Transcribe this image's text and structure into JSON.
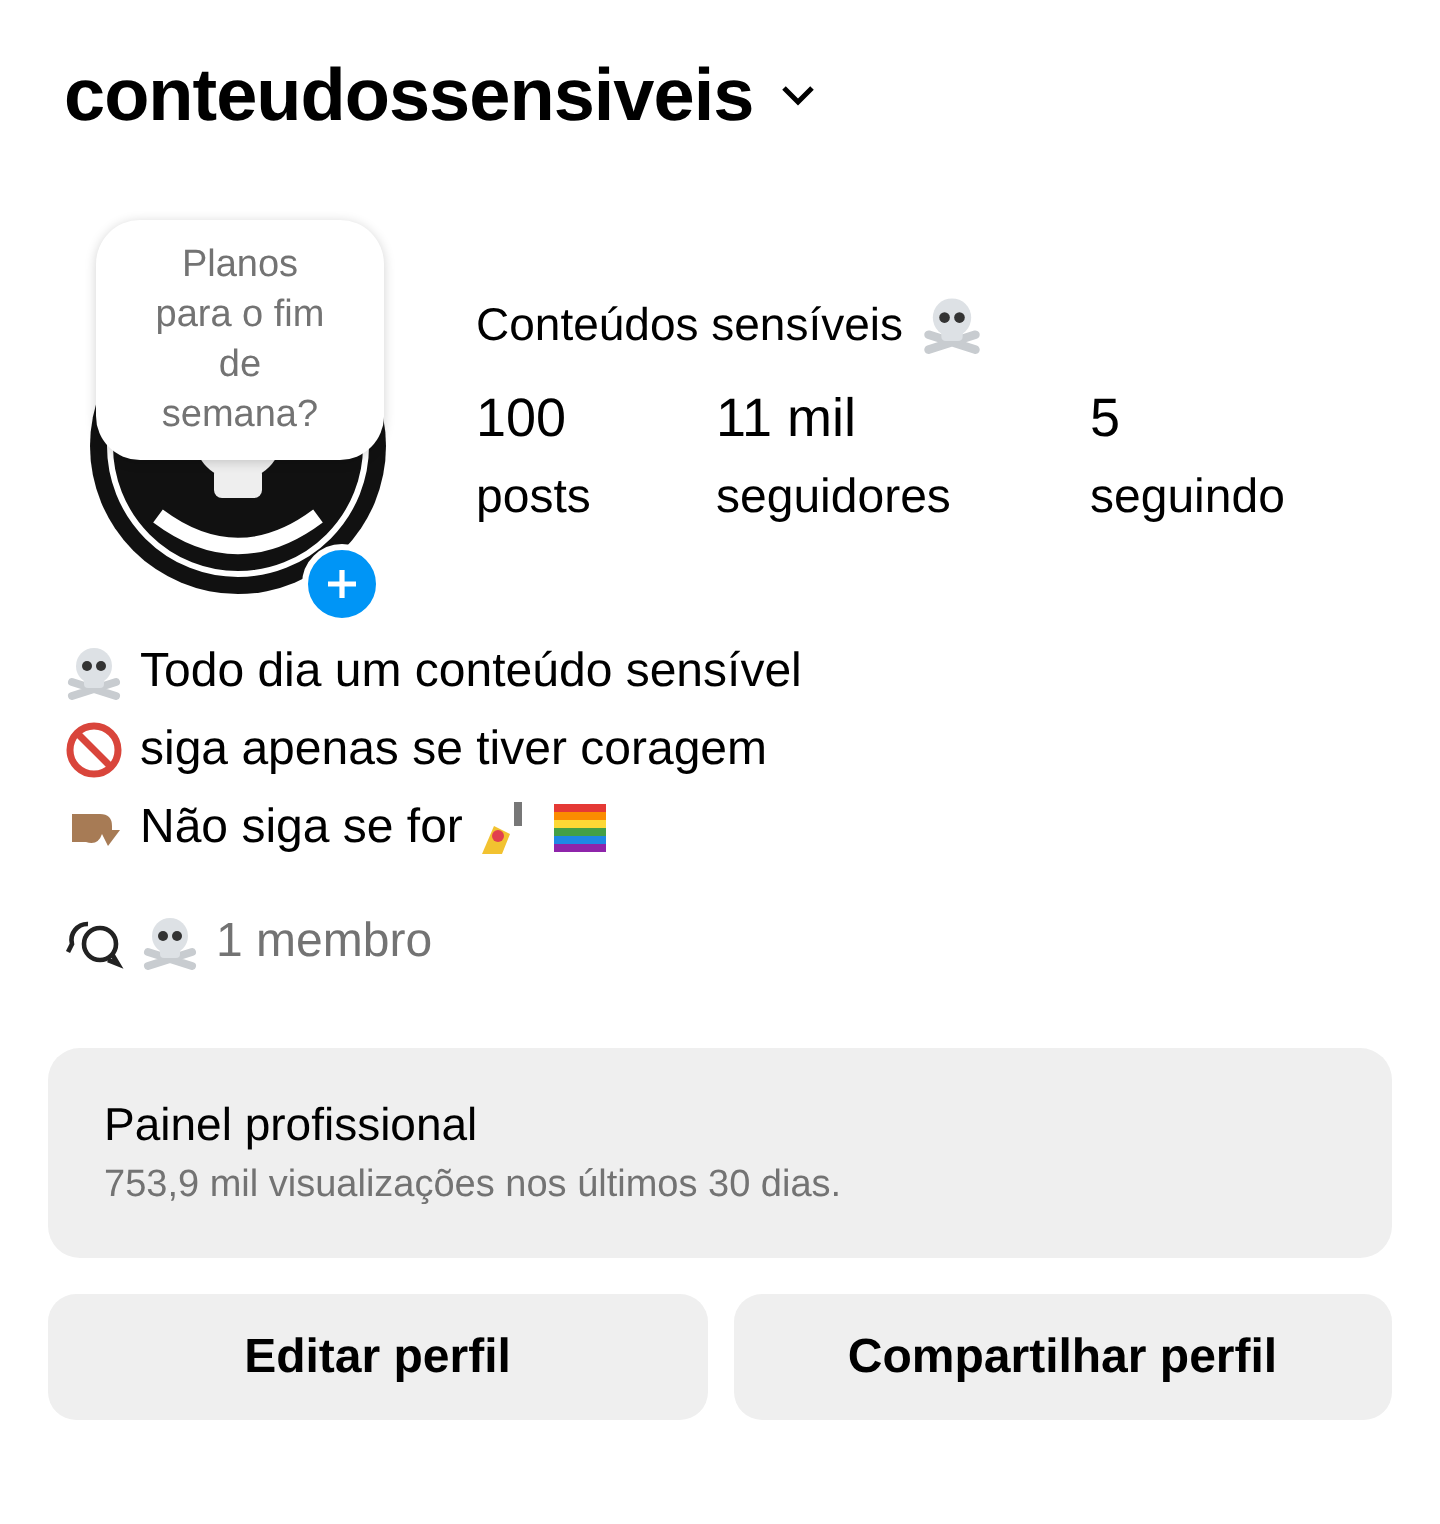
{
  "username": "conteudossensiveis",
  "note": "Planos para o fim de semana?",
  "display_name": "Conteúdos sensíveis",
  "stats": [
    {
      "value": "100",
      "label": "posts"
    },
    {
      "value": "11 mil",
      "label": "seguidores"
    },
    {
      "value": "5",
      "label": "seguindo"
    }
  ],
  "bio": [
    {
      "kind": "skull",
      "text": "Todo dia um conteúdo sensível"
    },
    {
      "kind": "prohibited",
      "text": "siga apenas se tiver coragem"
    },
    {
      "kind": "pointing",
      "text": "Não siga se for"
    }
  ],
  "channel": {
    "text": "1 membro"
  },
  "dashboard": {
    "title": "Painel profissional",
    "subtitle": "753,9 mil visualizações nos últimos 30 dias."
  },
  "buttons": [
    "Editar perfil",
    "Compartilhar perfil"
  ]
}
